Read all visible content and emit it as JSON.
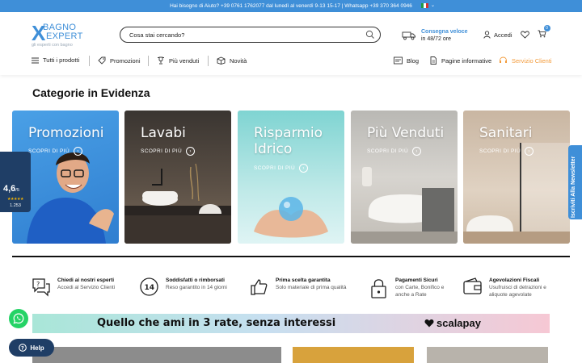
{
  "topbar": {
    "text": "Hai bisogno di Aiuto? +39 0761 1762077 dal lunedì al venerdì 9-13 15-17 | Whatsapp +39 370 364 0946",
    "lang_caret": "⌄"
  },
  "logo": {
    "line1": "BAGNO",
    "line2": "EXPERT",
    "tagline": "gli esperti con bagno"
  },
  "search": {
    "placeholder": "Cosa stai cercando?"
  },
  "shipping": {
    "title": "Consegna veloce",
    "subtitle": "in 48/72 ore"
  },
  "account": {
    "login_label": "Accedi",
    "cart_count": "0"
  },
  "nav": {
    "all_products": "Tutti i prodotti",
    "promotions": "Promozioni",
    "best_sellers": "Più venduti",
    "news": "Novità",
    "blog": "Blog",
    "info_pages": "Pagine informative",
    "customer_service": "Servizio Clienti"
  },
  "categories": {
    "title": "Categorie in Evidenza",
    "cta": "SCOPRI DI PIÙ",
    "items": [
      {
        "title": "Promozioni"
      },
      {
        "title": "Lavabi"
      },
      {
        "title": "Risparmio Idrico"
      },
      {
        "title": "Più Venduti"
      },
      {
        "title": "Sanitari"
      }
    ]
  },
  "rating": {
    "score": "4,6",
    "scale": "/5",
    "stars": "★★★★★",
    "count": "1.253"
  },
  "newsletter": {
    "label": "Iscriviti Alla Newsletter"
  },
  "features": [
    {
      "title": "Chiedi ai nostri esperti",
      "text": "Accedi al Servizio Clienti"
    },
    {
      "title": "Soddisfatti o rimborsati",
      "text": "Reso garantito in 14 giorni"
    },
    {
      "title": "Prima scelta garantita",
      "text": "Solo materiale di prima qualità"
    },
    {
      "title": "Pagamenti Sicuri",
      "text": "con Carte, Bonifico e anche a Rate"
    },
    {
      "title": "Agevolazioni Fiscali",
      "text": "Usufruisci di detrazioni e aliquote agevolate"
    }
  ],
  "banner": {
    "text": "Quello che ami in 3 rate, senza interessi",
    "brand": "scalapay"
  },
  "help": {
    "label": "Help"
  },
  "colors": {
    "accent": "#3f8fd8",
    "navy": "#1f3e66",
    "orange": "#f39c3d",
    "whatsapp": "#25d366"
  }
}
